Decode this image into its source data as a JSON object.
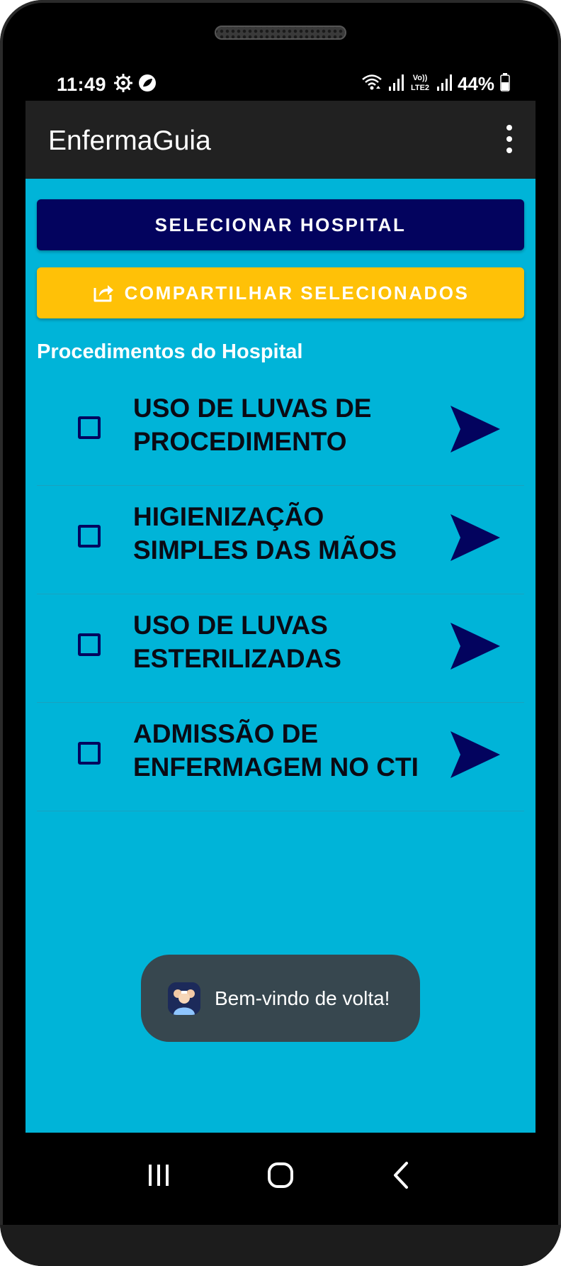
{
  "status_bar": {
    "time": "11:49",
    "battery_percent": "44%",
    "icons_left": [
      "settings-gear-icon",
      "leaf-notification-icon"
    ],
    "icons_right": [
      "wifi-icon",
      "signal-icon",
      "volte-lte2-icon",
      "signal-icon",
      "battery-icon"
    ]
  },
  "app_bar": {
    "title": "EnfermaGuia",
    "menu_icon": "overflow-menu-icon"
  },
  "buttons": {
    "select_hospital": "SELECIONAR HOSPITAL",
    "share_selected": "COMPARTILHAR SELECIONADOS",
    "share_icon": "share-icon"
  },
  "section": {
    "title": "Procedimentos do Hospital"
  },
  "procedures": [
    {
      "label": "USO DE LUVAS DE\nPROCEDIMENTO",
      "checked": false
    },
    {
      "label": "HIGIENIZAÇÃO\nSIMPLES DAS MÃOS",
      "checked": false
    },
    {
      "label": "USO DE LUVAS\nESTERILIZADAS",
      "checked": false
    },
    {
      "label": "ADMISSÃO DE\nENFERMAGEM NO CTI",
      "checked": false
    }
  ],
  "toast": {
    "message": "Bem-vindo de volta!"
  },
  "colors": {
    "background": "#00b4d8",
    "app_bar": "#212121",
    "primary_navy": "#03035e",
    "share_yellow": "#ffc107",
    "toast_bg": "#37474f"
  },
  "nav_bar": {
    "icons": [
      "recent-apps-icon",
      "home-icon",
      "back-icon"
    ]
  }
}
